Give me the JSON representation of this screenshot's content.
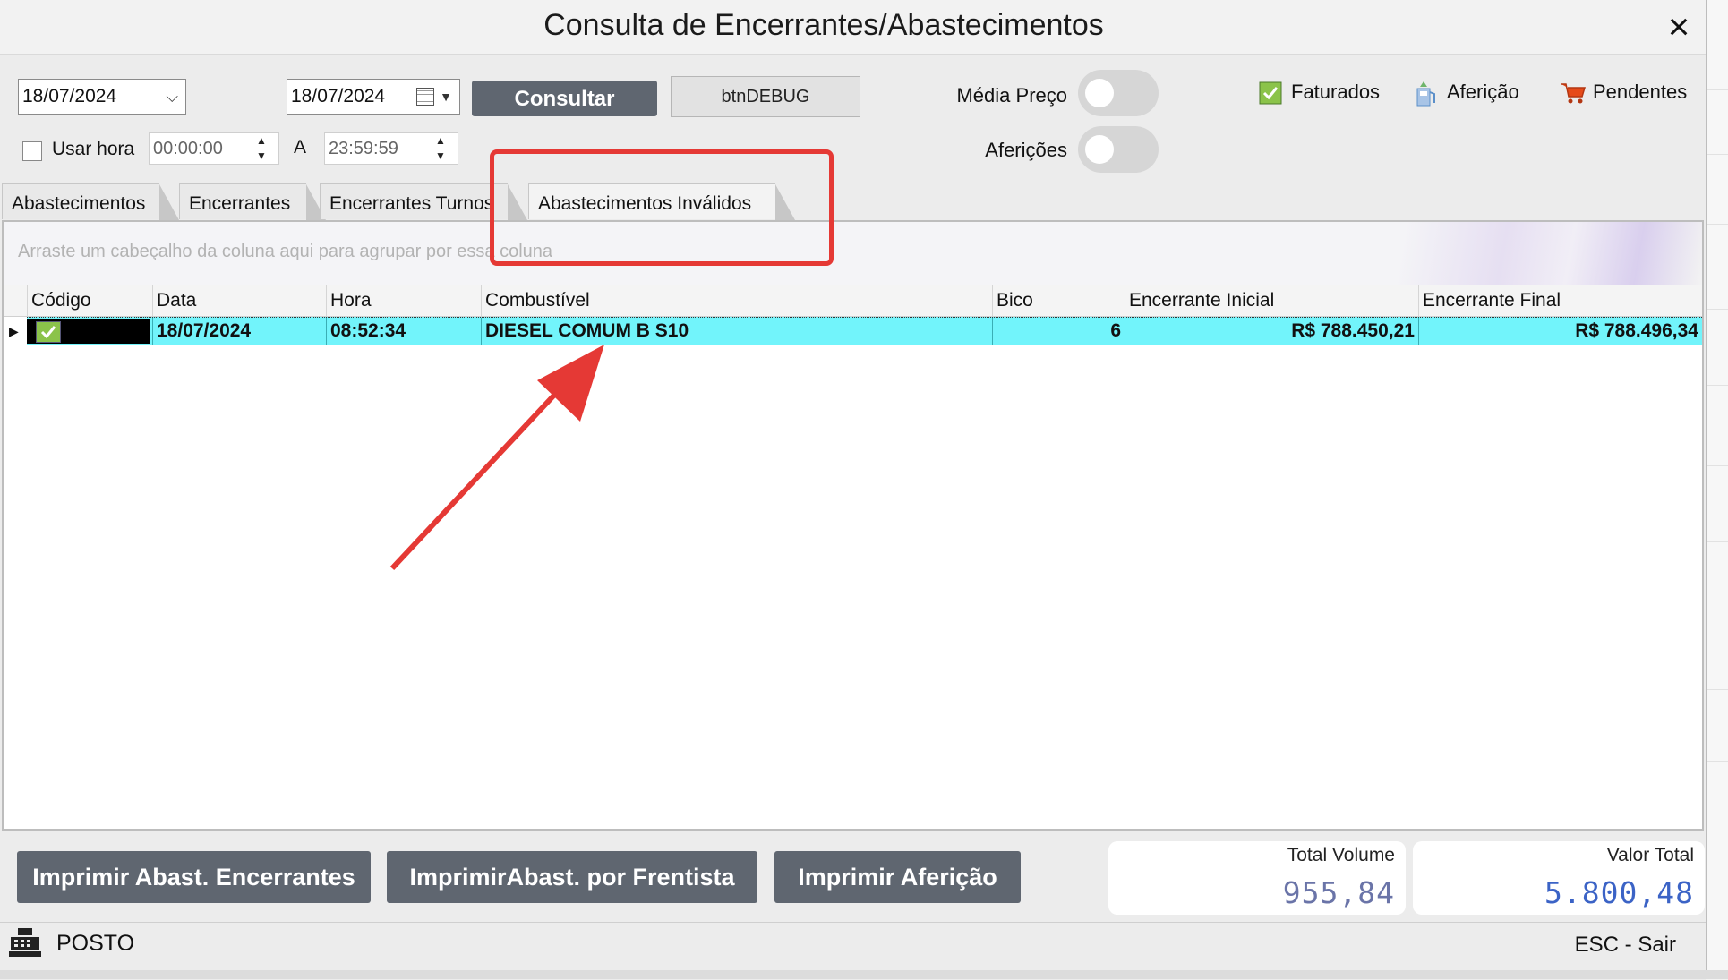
{
  "window": {
    "title": "Consulta de Encerrantes/Abastecimentos",
    "close_icon": "×"
  },
  "toolbar": {
    "date_from": "18/07/2024",
    "date_to": "18/07/2024",
    "consultar_label": "Consultar",
    "debug_label": "btnDEBUG",
    "usar_hora_label": "Usar hora",
    "time_from": "00:00:00",
    "time_separator": "A",
    "time_to": "23:59:59",
    "media_preco_label": "Média Preço",
    "afericoes_label": "Aferições",
    "media_preco_on": false,
    "afericoes_on": false
  },
  "legend": {
    "faturados": {
      "label": "Faturados",
      "icon": "check-icon",
      "color": "#8bc34a"
    },
    "afericao": {
      "label": "Aferição",
      "icon": "gas-pump-icon",
      "color": "#5b8fc9"
    },
    "pendentes": {
      "label": "Pendentes",
      "icon": "cart-icon",
      "color": "#e64a19"
    }
  },
  "tabs": [
    "Abastecimentos",
    "Encerrantes",
    "Encerrantes Turnos",
    "Abastecimentos Inválidos"
  ],
  "active_tab": 3,
  "grid": {
    "group_hint": "Arraste um cabeçalho da coluna aqui para agrupar por essa coluna",
    "columns": [
      "Código",
      "Data",
      "Hora",
      "Combustível",
      "Bico",
      "Encerrante Inicial",
      "Encerrante Final"
    ],
    "rows": [
      {
        "codigo": "",
        "data": "18/07/2024",
        "hora": "08:52:34",
        "combustivel": "DIESEL COMUM B S10",
        "bico": "6",
        "encerrante_inicial": "R$ 788.450,21",
        "encerrante_final": "R$ 788.496,34"
      }
    ],
    "selected_row_color": "#72f4fb"
  },
  "buttons": {
    "imprimir_encerrantes": "Imprimir Abast. Encerrantes",
    "imprimir_frentista": "ImprimirAbast. por Frentista",
    "imprimir_afericao": "Imprimir Aferição"
  },
  "totals": {
    "volume_label": "Total Volume",
    "volume_value": "955,84",
    "valor_label": "Valor Total",
    "valor_value": "5.800,48",
    "volume_color": "#6a74a8",
    "valor_color": "#3b63c6"
  },
  "status": {
    "posto_label": "POSTO",
    "esc_label": "ESC - Sair"
  },
  "annotation": {
    "highlight_color": "#e53935"
  }
}
